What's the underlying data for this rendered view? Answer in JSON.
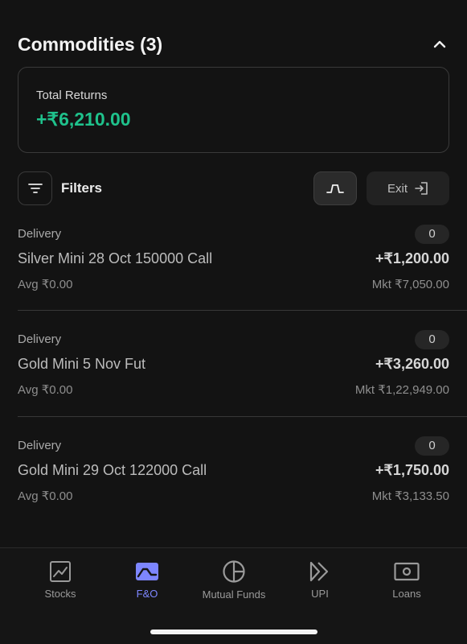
{
  "section": {
    "title": "Commodities (3)"
  },
  "returns": {
    "label": "Total Returns",
    "value": "+₹6,210.00",
    "color": "#1fc28c"
  },
  "toolbar": {
    "filters_label": "Filters",
    "exit_label": "Exit"
  },
  "positions": [
    {
      "type": "Delivery",
      "qty": "0",
      "name": "Silver Mini 28 Oct 150000 Call",
      "pnl": "+₹1,200.00",
      "avg": "Avg ₹0.00",
      "mkt": "Mkt ₹7,050.00"
    },
    {
      "type": "Delivery",
      "qty": "0",
      "name": "Gold Mini 5 Nov Fut",
      "pnl": "+₹3,260.00",
      "avg": "Avg ₹0.00",
      "mkt": "Mkt ₹1,22,949.00"
    },
    {
      "type": "Delivery",
      "qty": "0",
      "name": "Gold Mini 29 Oct 122000 Call",
      "pnl": "+₹1,750.00",
      "avg": "Avg ₹0.00",
      "mkt": "Mkt ₹3,133.50"
    }
  ],
  "nav": {
    "active": "F&O",
    "accent": "#7d86ff",
    "items": [
      {
        "label": "Stocks",
        "icon": "stocks-chart-icon"
      },
      {
        "label": "F&O",
        "icon": "fno-wave-icon"
      },
      {
        "label": "Mutual Funds",
        "icon": "pie-chart-icon"
      },
      {
        "label": "UPI",
        "icon": "upi-arrows-icon"
      },
      {
        "label": "Loans",
        "icon": "banknote-icon"
      }
    ]
  }
}
